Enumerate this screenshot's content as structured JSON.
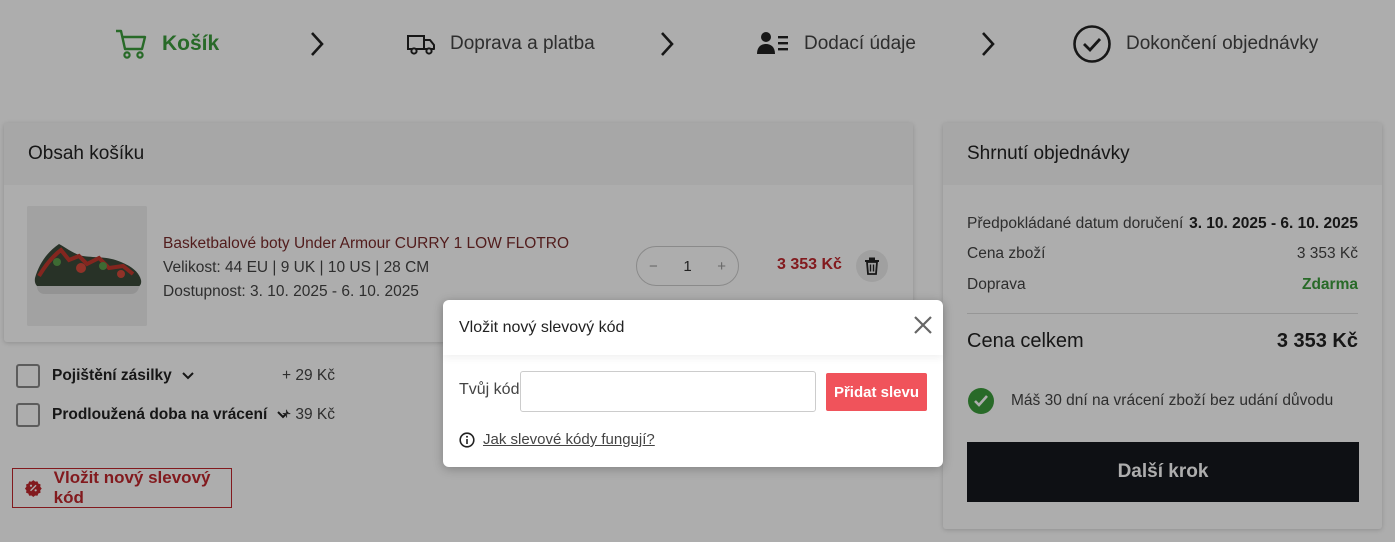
{
  "steps": [
    {
      "label": "Košík",
      "icon": "cart-icon",
      "active": true
    },
    {
      "label": "Doprava a platba",
      "icon": "truck-icon"
    },
    {
      "label": "Dodací údaje",
      "icon": "user-list-icon"
    },
    {
      "label": "Dokončení objednávky",
      "icon": "check-circle-icon"
    }
  ],
  "cart": {
    "title": "Obsah košíku",
    "item": {
      "name": "Basketbalové boty Under Armour CURRY 1 LOW FLOTRO",
      "size": "Velikost: 44 EU | 9 UK | 10 US | 28 CM",
      "availability": "Dostupnost:  3. 10. 2025 - 6. 10. 2025",
      "quantity": "1",
      "qty_minus": "−",
      "qty_plus": "+",
      "price": "3 353 Kč"
    },
    "options": [
      {
        "label": "Pojištění zásilky",
        "price": "+ 29 Kč"
      },
      {
        "label": "Prodloužená doba na vrácení",
        "price": "+ 39 Kč"
      }
    ],
    "coupon_button": "Vložit nový slevový kód"
  },
  "summary": {
    "title": "Shrnutí objednávky",
    "delivery_label": "Předpokládané datum doručení",
    "delivery_value": "3. 10. 2025 - 6. 10. 2025",
    "goods_label": "Cena zboží",
    "goods_value": "3 353 Kč",
    "shipping_label": "Doprava",
    "shipping_value": "Zdarma",
    "total_label": "Cena celkem",
    "total_value": "3 353 Kč",
    "returns_text": "Máš 30 dní na vrácení zboží bez udání důvodu",
    "next_button": "Další krok"
  },
  "modal": {
    "title": "Vložit nový slevový kód",
    "code_label": "Tvůj kód",
    "code_value": "",
    "add_button": "Přidat slevu",
    "help_link": "Jak slevové kódy fungují?"
  },
  "colors": {
    "accent_green": "#3c9c3c",
    "price_red": "#c0272d",
    "add_button_red": "#f0535b",
    "dark_button": "#15181e"
  }
}
